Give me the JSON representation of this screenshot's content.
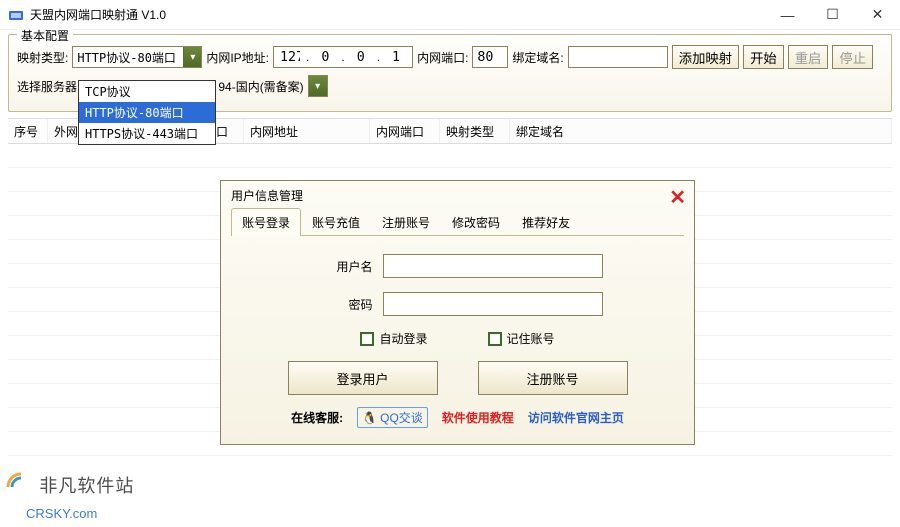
{
  "window": {
    "title": "天盟内网端口映射通 V1.0",
    "min": "—",
    "max": "☐",
    "close": "✕"
  },
  "config": {
    "group_title": "基本配置",
    "mapping_type_label": "映射类型:",
    "mapping_type_value": "HTTP协议-80端口",
    "dropdown": {
      "opt0": "TCP协议",
      "opt1": "HTTP协议-80端口",
      "opt2": "HTTPS协议-443端口"
    },
    "lan_ip_label": "内网IP地址:",
    "ip": {
      "a": "127",
      "b": "0",
      "c": "0",
      "d": "1"
    },
    "lan_port_label": "内网端口:",
    "lan_port": "80",
    "domain_label": "绑定域名:",
    "domain_value": "",
    "btn_add": "添加映射",
    "btn_start": "开始",
    "btn_restart": "重启",
    "btn_stop": "停止",
    "server_label": "选择服务器:",
    "server_suffix": "94-国内(需备案)"
  },
  "table": {
    "h0": "序号",
    "h1": "外网地址",
    "h2": "外网端口",
    "h3": "内网地址",
    "h4": "内网端口",
    "h5": "映射类型",
    "h6": "绑定域名"
  },
  "dialog": {
    "title": "用户信息管理",
    "tabs": {
      "t0": "账号登录",
      "t1": "账号充值",
      "t2": "注册账号",
      "t3": "修改密码",
      "t4": "推荐好友"
    },
    "user_label": "用户名",
    "pass_label": "密码",
    "auto_login": "自动登录",
    "remember": "记住账号",
    "btn_login": "登录用户",
    "btn_register": "注册账号",
    "service_label": "在线客服:",
    "qq_text": "QQ交谈",
    "link_tutorial": "软件使用教程",
    "link_site": "访问软件官网主页"
  },
  "watermark": {
    "line1": "非凡软件站",
    "line2": "CRSKY.com"
  }
}
